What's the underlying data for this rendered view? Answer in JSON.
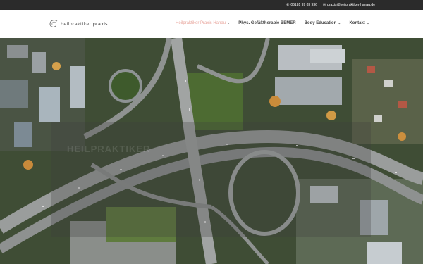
{
  "topbar": {
    "phone": "06181 99 83 936",
    "email": "praxis@heilpraktiker-hanau.de",
    "phone_icon": "phone-icon",
    "email_icon": "mail-icon"
  },
  "logo": {
    "text_a": "heilpraktiker",
    "text_b": "praxis"
  },
  "nav": {
    "items": [
      {
        "label": "Heilpraktiker Praxis Hanau",
        "active": true,
        "has_dropdown": true
      },
      {
        "label": "Phys. Gefäßtherapie BEMER",
        "active": false,
        "has_dropdown": false
      },
      {
        "label": "Body Education",
        "active": false,
        "has_dropdown": true
      },
      {
        "label": "Kontakt",
        "active": false,
        "has_dropdown": true
      }
    ]
  },
  "hero": {
    "watermark": "HEILPRAKTIKER"
  },
  "colors": {
    "accent": "#e8a49b",
    "topbar_bg": "#2b2b2b"
  }
}
